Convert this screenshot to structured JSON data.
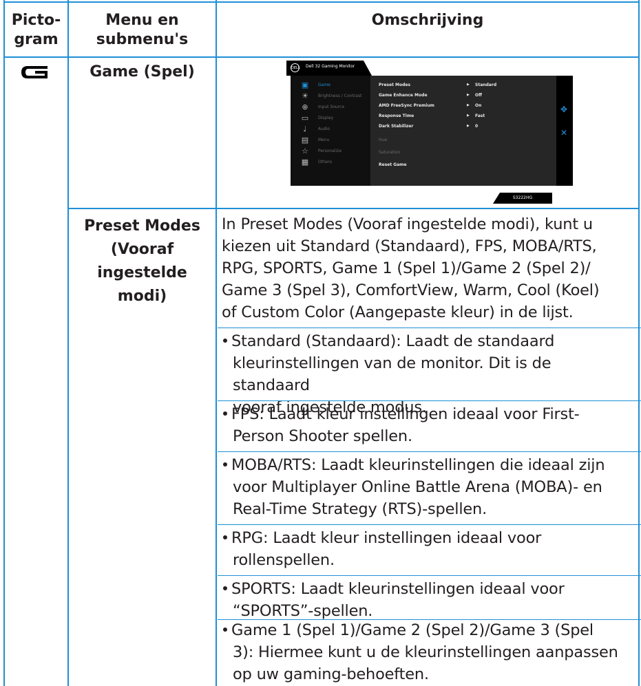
{
  "headers": {
    "col1": "Picto-\ngram",
    "col1_line1": "Picto-",
    "col1_line2": "gram",
    "col2_line1": "Menu en",
    "col2_line2": "submenu's",
    "col3": "Omschrijving"
  },
  "game_row": {
    "icon": "game-icon",
    "label": "Game (Spel)"
  },
  "osd": {
    "title": "Dell 32 Gaming Monitor",
    "logo": "DELL",
    "model": "S3222HG",
    "menu": [
      "Game",
      "Brightness / Contrast",
      "Input Source",
      "Display",
      "Audio",
      "Menu",
      "Personalize",
      "Others"
    ],
    "settings": [
      {
        "label": "Preset Modes",
        "value": "Standard"
      },
      {
        "label": "Game Enhance Mode",
        "value": "Off"
      },
      {
        "label": "AMD FreeSync Premium",
        "value": "On"
      },
      {
        "label": "Response Time",
        "value": "Fast"
      },
      {
        "label": "Dark Stabilizer",
        "value": "0"
      },
      {
        "label": "Hue",
        "value": ""
      },
      {
        "label": "Saturation",
        "value": ""
      },
      {
        "label": "Reset Game",
        "value": ""
      }
    ]
  },
  "preset_row": {
    "label_lines": [
      "Preset Modes",
      "(Vooraf",
      "ingestelde",
      "modi)"
    ],
    "intro_lines": [
      "In Preset Modes (Vooraf ingestelde modi), kunt u",
      "kiezen uit Standard (Standaard), FPS, MOBA/RTS,",
      "RPG, SPORTS, Game 1 (Spel 1)/Game 2 (Spel 2)/",
      "Game 3 (Spel 3), ComfortView, Warm, Cool (Koel)",
      "of Custom Color (Aangepaste kleur) in de lijst."
    ],
    "bullets": [
      [
        "Standard (Standaard): Laadt de standaard",
        "kleurinstellingen van de monitor. Dit is de standaard",
        "vooraf ingestelde modus."
      ],
      [
        "FPS: Laadt kleur instellingen ideaal voor First-",
        "Person Shooter spellen."
      ],
      [
        "MOBA/RTS: Laadt kleurinstellingen die ideaal zijn",
        "voor Multiplayer Online Battle Arena (MOBA)- en",
        "Real-Time Strategy (RTS)-spellen."
      ],
      [
        "RPG: Laadt kleur instellingen ideaal voor",
        "rollenspellen."
      ],
      [
        "SPORTS: Laadt kleurinstellingen ideaal voor",
        "“SPORTS”-spellen."
      ],
      [
        "Game 1 (Spel 1)/Game 2 (Spel 2)/Game 3 (Spel",
        "3): Hiermee kunt u de kleurinstellingen aanpassen",
        "op uw gaming-behoeften."
      ]
    ]
  },
  "colors": {
    "border": "#1e8fd6",
    "text": "#231f20",
    "osd_accent": "#1e8fd6"
  }
}
